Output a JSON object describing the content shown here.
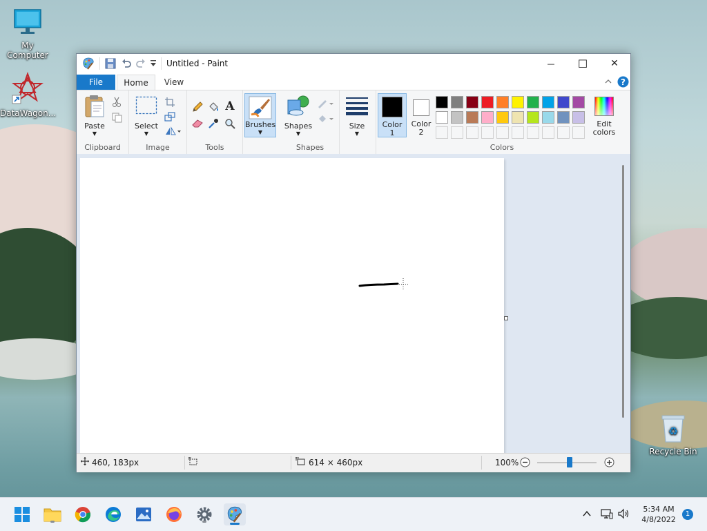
{
  "desktop": {
    "icons": [
      {
        "label": "My Computer"
      },
      {
        "label": "DataWagon..."
      },
      {
        "label": "Recycle Bin"
      }
    ]
  },
  "window": {
    "title": "Untitled - Paint",
    "controls": {
      "minimize": "—",
      "maximize": "☐",
      "close": "✕"
    }
  },
  "tabs": [
    {
      "label": "File"
    },
    {
      "label": "Home"
    },
    {
      "label": "View"
    }
  ],
  "ribbon": {
    "clipboard": {
      "paste": "Paste",
      "group": "Clipboard"
    },
    "image": {
      "select": "Select",
      "group": "Image"
    },
    "tools": {
      "group": "Tools"
    },
    "brushes": {
      "label": "Brushes"
    },
    "shapes": {
      "label": "Shapes",
      "group": "Shapes"
    },
    "size": {
      "label": "Size"
    },
    "colors": {
      "color1_l1": "Color",
      "color1_l2": "1",
      "color2_l1": "Color",
      "color2_l2": "2",
      "edit_l1": "Edit",
      "edit_l2": "colors",
      "group": "Colors",
      "color1": "#000000",
      "color2": "#ffffff",
      "palette_row1": [
        "#000000",
        "#7f7f7f",
        "#880015",
        "#ed1c24",
        "#ff7f27",
        "#fff200",
        "#22b14c",
        "#00a2e8",
        "#3f48cc",
        "#a349a4"
      ],
      "palette_row2": [
        "#ffffff",
        "#c3c3c3",
        "#b97a57",
        "#ffaec9",
        "#ffc90e",
        "#efe4b0",
        "#b5e61d",
        "#99d9ea",
        "#7092be",
        "#c8bfe7"
      ]
    }
  },
  "status": {
    "cursor": "460, 183px",
    "canvas_size": "614 × 460px",
    "zoom": "100%",
    "zoom_level": 0.5
  },
  "taskbar": {
    "time": "5:34 AM",
    "date": "4/8/2022",
    "notifications": "1"
  },
  "accent": "#1979ca"
}
